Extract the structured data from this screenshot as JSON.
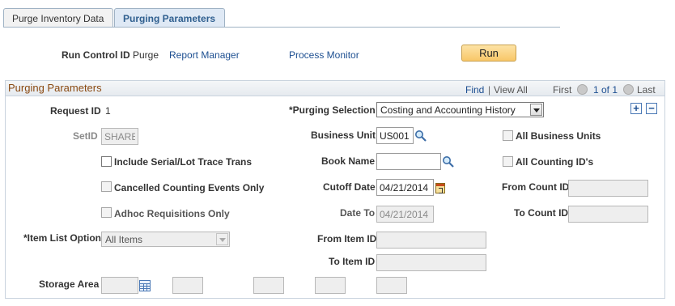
{
  "tabs": [
    {
      "label": "Purge Inventory Data",
      "active": false
    },
    {
      "label": "Purging Parameters",
      "active": true
    }
  ],
  "header": {
    "run_control_label": "Run Control ID",
    "run_control_value": "Purge",
    "report_manager": "Report Manager",
    "process_monitor": "Process Monitor",
    "run_button": "Run"
  },
  "group": {
    "title": "Purging Parameters",
    "find": "Find",
    "separator": "|",
    "view_all": "View All",
    "first": "First",
    "range": "1 of 1",
    "last": "Last",
    "add_button": "+",
    "delete_button": "−"
  },
  "fields": {
    "request_id_label": "Request ID",
    "request_id_value": "1",
    "purging_selection_label": "*Purging Selection",
    "purging_selection_value": "Costing and Accounting History",
    "setid_label": "SetID",
    "setid_value": "SHARE",
    "business_unit_label": "Business Unit",
    "business_unit_value": "US001",
    "all_business_units_label": "All Business Units",
    "include_serial_label": "Include Serial/Lot Trace Trans",
    "book_name_label": "Book Name",
    "book_name_value": "",
    "all_counting_label": "All Counting ID's",
    "cancelled_label": "Cancelled Counting Events Only",
    "cutoff_date_label": "Cutoff Date",
    "cutoff_date_value": "04/21/2014",
    "from_count_label": "From Count ID",
    "from_count_value": "",
    "adhoc_label": "Adhoc Requisitions Only",
    "date_to_label": "Date To",
    "date_to_value": "04/21/2014",
    "to_count_label": "To Count ID",
    "to_count_value": "",
    "item_list_label": "*Item List Option",
    "item_list_value": "All Items",
    "from_item_label": "From Item ID",
    "from_item_value": "",
    "to_item_label": "To Item ID",
    "to_item_value": "",
    "storage_area_label": "Storage Area",
    "storage_area_values": [
      "",
      "",
      "",
      "",
      ""
    ]
  },
  "icons": {
    "lookup": "magnifier-icon",
    "calendar": "calendar-icon",
    "grid": "grid-lookup-icon"
  }
}
